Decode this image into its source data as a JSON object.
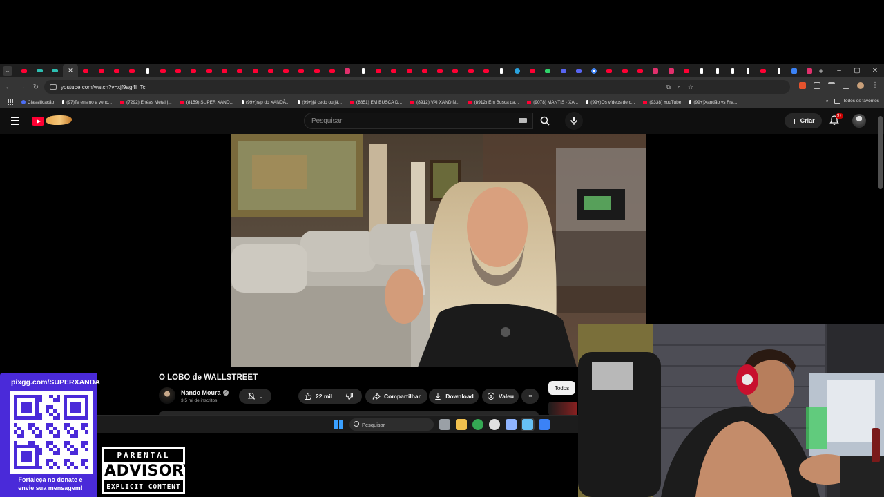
{
  "browser": {
    "url": "youtube.com/watch?v=xjf9ag4I_Tc",
    "tabs": [
      "yt",
      "code",
      "code",
      "x",
      "yt",
      "yt",
      "yt",
      "yt",
      "tiktok",
      "yt",
      "yt",
      "yt",
      "yt",
      "yt",
      "yt",
      "yt",
      "yt",
      "yt",
      "yt",
      "yt",
      "yt",
      "ig",
      "tiktok",
      "yt",
      "yt",
      "yt",
      "yt",
      "yt",
      "yt",
      "yt",
      "yt",
      "tiktok",
      "tg",
      "yt",
      "green",
      "purple",
      "purple",
      "google",
      "yt",
      "yt",
      "yt",
      "ig",
      "ig",
      "yt",
      "tiktok",
      "tiktok",
      "tiktok",
      "tiktok",
      "yt",
      "tiktok",
      "blue",
      "ig"
    ],
    "new_tab": "+",
    "window_controls": [
      "–",
      "▢",
      "✕"
    ],
    "bookmarks": [
      {
        "icon": "blue",
        "label": "Classificação"
      },
      {
        "icon": "tt",
        "label": "(97)Te ensino a venc..."
      },
      {
        "icon": "yt",
        "label": "(7292) Enéas Metal |..."
      },
      {
        "icon": "yt",
        "label": "(8159) SUPER XAND..."
      },
      {
        "icon": "tt",
        "label": "(99+)rap do XANDÃ..."
      },
      {
        "icon": "tt",
        "label": "(99+)já cedo ou já..."
      },
      {
        "icon": "yt",
        "label": "(8851) EM BUSCA D..."
      },
      {
        "icon": "yt",
        "label": "(8912) VAI XANDIN..."
      },
      {
        "icon": "yt",
        "label": "(8912) Em Busca da..."
      },
      {
        "icon": "yt",
        "label": "(9078) MANTIS · XA..."
      },
      {
        "icon": "tt",
        "label": "(99+)Os vídeos de c..."
      },
      {
        "icon": "yt",
        "label": "(9338) YouTube"
      },
      {
        "icon": "tt",
        "label": "(99+)Xandão vs Fra..."
      }
    ],
    "bookmarks_more": "»",
    "all_bookmarks": "Todos os favoritos"
  },
  "youtube": {
    "search_placeholder": "Pesquisar",
    "create_label": "Criar",
    "notifications_badge": "9+",
    "video_title": "O LOBO de WALLSTREET",
    "channel_name": "Nando Moura",
    "subscribers": "3,5 mi de inscritos",
    "likes": "22 mil",
    "share_label": "Compartilhar",
    "download_label": "Download",
    "thanks_label": "Valeu",
    "more_label": "•••",
    "filter_chip": "Todos"
  },
  "taskbar": {
    "search_label": "Pesquisar",
    "icons": [
      {
        "name": "task-view-icon",
        "color": "#9aa0a6"
      },
      {
        "name": "file-explorer-icon",
        "color": "#f2c14e"
      },
      {
        "name": "chrome-icon",
        "color": "#34a853"
      },
      {
        "name": "chrome-profile-icon",
        "color": "#e0e0e0"
      },
      {
        "name": "settings-icon",
        "color": "#8fb4ff"
      },
      {
        "name": "steam-icon",
        "color": "#66c0f4"
      },
      {
        "name": "app-icon",
        "color": "#3b82f6"
      }
    ]
  },
  "overlays": {
    "donate_url": "pixgg.com/SUPERXANDA",
    "donate_line1": "Fortaleça no donate e",
    "donate_line2": "envie sua mensagem!",
    "advisory_top": "PARENTAL",
    "advisory_mid": "ADVISORY",
    "advisory_bottom": "EXPLICIT CONTENT"
  },
  "colors": {
    "youtube_red": "#ff0033",
    "donate_purple": "#4a2ad9",
    "page_bg": "#0f0f0f"
  }
}
